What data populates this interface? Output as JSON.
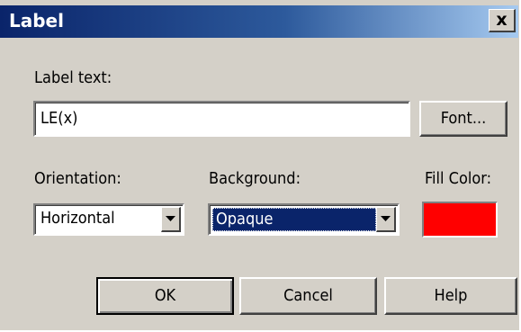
{
  "window": {
    "title": "Label",
    "close_glyph": "x"
  },
  "label_text": {
    "caption": "Label text:",
    "value": "LE(x)",
    "font_button": "Font..."
  },
  "orientation": {
    "caption": "Orientation:",
    "selected": "Horizontal"
  },
  "background": {
    "caption": "Background:",
    "selected": "Opaque"
  },
  "fill_color": {
    "caption": "Fill Color:",
    "color": "#ff0000"
  },
  "buttons": {
    "ok": "OK",
    "cancel": "Cancel",
    "help": "Help"
  },
  "icons": {
    "close": "close-icon",
    "dropdown": "chevron-down-icon"
  }
}
